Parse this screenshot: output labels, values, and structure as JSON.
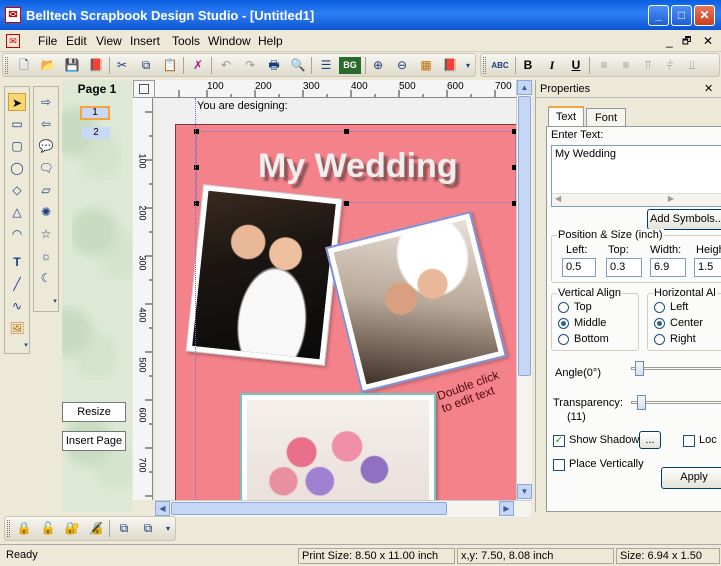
{
  "window": {
    "title": "Belltech Scrapbook Design Studio - [Untitled1]",
    "app_icon": "scrapbook-app-icon"
  },
  "window_controls": {
    "minimize": "_",
    "maximize": "□",
    "close": "✕"
  },
  "menu": {
    "items": [
      "File",
      "Edit",
      "View",
      "Insert",
      "Tools",
      "Window",
      "Help"
    ],
    "mdi_minimize": "_",
    "mdi_restore": "🗗",
    "mdi_close": "✕"
  },
  "toolbar_main": {
    "icons": [
      "new-icon",
      "open-icon",
      "save-icon",
      "pdf-icon",
      "cut-icon",
      "copy-icon",
      "paste-icon",
      "delete-icon",
      "undo-icon",
      "redo-icon",
      "print-icon",
      "print-preview-icon",
      "properties-icon",
      "background-icon",
      "zoom-in-icon",
      "zoom-out-icon",
      "grid-icon",
      "book-icon"
    ],
    "bg_label": "BG"
  },
  "toolbar_text": {
    "spell": "ABC",
    "bold": "B",
    "italic": "I",
    "underline": "U"
  },
  "page_panel": {
    "title": "Page 1",
    "thumbs": [
      "1",
      "2"
    ],
    "resize_label": "Resize",
    "insert_page_label": "Insert Page"
  },
  "ruler": {
    "h_ticks": [
      "100",
      "200",
      "300",
      "400",
      "500",
      "600",
      "700"
    ],
    "v_ticks": [
      "100",
      "200",
      "300",
      "400",
      "500",
      "600",
      "700"
    ]
  },
  "canvas": {
    "designing_label": "You are designing:",
    "wedding_title": "My Wedding",
    "caption_line1": "Double click",
    "caption_line2": "to edit text",
    "page_color": "#f4828a"
  },
  "properties": {
    "title": "Properties",
    "close": "✕",
    "tabs": [
      "Text",
      "Font"
    ],
    "enter_text_label": "Enter Text:",
    "text_value": "My Wedding",
    "add_symbols": "Add Symbols...",
    "position_group": "Position & Size (inch)",
    "left_label": "Left:",
    "left_value": "0.5",
    "top_label": "Top:",
    "top_value": "0.3",
    "width_label": "Width:",
    "width_value": "6.9",
    "height_label": "Heigh",
    "height_value": "1.5",
    "valign_group": "Vertical Align",
    "valign_options": [
      "Top",
      "Middle",
      "Bottom"
    ],
    "halign_group": "Horizontal Al",
    "halign_options": [
      "Left",
      "Center",
      "Right"
    ],
    "angle_label": "Angle(0°)",
    "transparency_label": "Transparency:",
    "transparency_value": "(11)",
    "show_shadow_label": "Show Shadow",
    "shadow_btn": "...",
    "lock_label": "Loc",
    "place_vertically_label": "Place Vertically",
    "apply_label": "Apply"
  },
  "status": {
    "ready": "Ready",
    "print_size": "Print Size: 8.50 x 11.00 inch",
    "coords": "x,y: 7.50, 8.08 inch",
    "size": "Size: 6.94 x 1.50"
  },
  "colors": {
    "accent": "#0a5fe0",
    "page": "#f4828a",
    "tab_highlight": "#f7a43a"
  }
}
